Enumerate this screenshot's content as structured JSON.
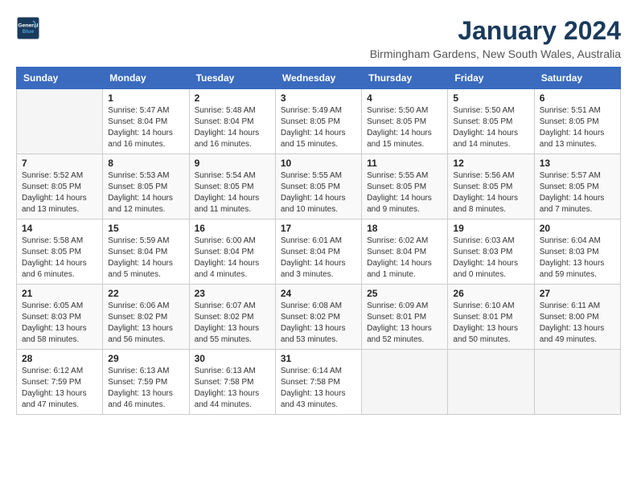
{
  "logo": {
    "line1": "General",
    "line2": "Blue"
  },
  "title": "January 2024",
  "location": "Birmingham Gardens, New South Wales, Australia",
  "weekdays": [
    "Sunday",
    "Monday",
    "Tuesday",
    "Wednesday",
    "Thursday",
    "Friday",
    "Saturday"
  ],
  "weeks": [
    [
      {
        "day": null,
        "info": null
      },
      {
        "day": "1",
        "sunrise": "5:47 AM",
        "sunset": "8:04 PM",
        "daylight": "14 hours and 16 minutes."
      },
      {
        "day": "2",
        "sunrise": "5:48 AM",
        "sunset": "8:04 PM",
        "daylight": "14 hours and 16 minutes."
      },
      {
        "day": "3",
        "sunrise": "5:49 AM",
        "sunset": "8:05 PM",
        "daylight": "14 hours and 15 minutes."
      },
      {
        "day": "4",
        "sunrise": "5:50 AM",
        "sunset": "8:05 PM",
        "daylight": "14 hours and 15 minutes."
      },
      {
        "day": "5",
        "sunrise": "5:50 AM",
        "sunset": "8:05 PM",
        "daylight": "14 hours and 14 minutes."
      },
      {
        "day": "6",
        "sunrise": "5:51 AM",
        "sunset": "8:05 PM",
        "daylight": "14 hours and 13 minutes."
      }
    ],
    [
      {
        "day": "7",
        "sunrise": "5:52 AM",
        "sunset": "8:05 PM",
        "daylight": "14 hours and 13 minutes."
      },
      {
        "day": "8",
        "sunrise": "5:53 AM",
        "sunset": "8:05 PM",
        "daylight": "14 hours and 12 minutes."
      },
      {
        "day": "9",
        "sunrise": "5:54 AM",
        "sunset": "8:05 PM",
        "daylight": "14 hours and 11 minutes."
      },
      {
        "day": "10",
        "sunrise": "5:55 AM",
        "sunset": "8:05 PM",
        "daylight": "14 hours and 10 minutes."
      },
      {
        "day": "11",
        "sunrise": "5:55 AM",
        "sunset": "8:05 PM",
        "daylight": "14 hours and 9 minutes."
      },
      {
        "day": "12",
        "sunrise": "5:56 AM",
        "sunset": "8:05 PM",
        "daylight": "14 hours and 8 minutes."
      },
      {
        "day": "13",
        "sunrise": "5:57 AM",
        "sunset": "8:05 PM",
        "daylight": "14 hours and 7 minutes."
      }
    ],
    [
      {
        "day": "14",
        "sunrise": "5:58 AM",
        "sunset": "8:05 PM",
        "daylight": "14 hours and 6 minutes."
      },
      {
        "day": "15",
        "sunrise": "5:59 AM",
        "sunset": "8:04 PM",
        "daylight": "14 hours and 5 minutes."
      },
      {
        "day": "16",
        "sunrise": "6:00 AM",
        "sunset": "8:04 PM",
        "daylight": "14 hours and 4 minutes."
      },
      {
        "day": "17",
        "sunrise": "6:01 AM",
        "sunset": "8:04 PM",
        "daylight": "14 hours and 3 minutes."
      },
      {
        "day": "18",
        "sunrise": "6:02 AM",
        "sunset": "8:04 PM",
        "daylight": "14 hours and 1 minute."
      },
      {
        "day": "19",
        "sunrise": "6:03 AM",
        "sunset": "8:03 PM",
        "daylight": "14 hours and 0 minutes."
      },
      {
        "day": "20",
        "sunrise": "6:04 AM",
        "sunset": "8:03 PM",
        "daylight": "13 hours and 59 minutes."
      }
    ],
    [
      {
        "day": "21",
        "sunrise": "6:05 AM",
        "sunset": "8:03 PM",
        "daylight": "13 hours and 58 minutes."
      },
      {
        "day": "22",
        "sunrise": "6:06 AM",
        "sunset": "8:02 PM",
        "daylight": "13 hours and 56 minutes."
      },
      {
        "day": "23",
        "sunrise": "6:07 AM",
        "sunset": "8:02 PM",
        "daylight": "13 hours and 55 minutes."
      },
      {
        "day": "24",
        "sunrise": "6:08 AM",
        "sunset": "8:02 PM",
        "daylight": "13 hours and 53 minutes."
      },
      {
        "day": "25",
        "sunrise": "6:09 AM",
        "sunset": "8:01 PM",
        "daylight": "13 hours and 52 minutes."
      },
      {
        "day": "26",
        "sunrise": "6:10 AM",
        "sunset": "8:01 PM",
        "daylight": "13 hours and 50 minutes."
      },
      {
        "day": "27",
        "sunrise": "6:11 AM",
        "sunset": "8:00 PM",
        "daylight": "13 hours and 49 minutes."
      }
    ],
    [
      {
        "day": "28",
        "sunrise": "6:12 AM",
        "sunset": "7:59 PM",
        "daylight": "13 hours and 47 minutes."
      },
      {
        "day": "29",
        "sunrise": "6:13 AM",
        "sunset": "7:59 PM",
        "daylight": "13 hours and 46 minutes."
      },
      {
        "day": "30",
        "sunrise": "6:13 AM",
        "sunset": "7:58 PM",
        "daylight": "13 hours and 44 minutes."
      },
      {
        "day": "31",
        "sunrise": "6:14 AM",
        "sunset": "7:58 PM",
        "daylight": "13 hours and 43 minutes."
      },
      {
        "day": null,
        "info": null
      },
      {
        "day": null,
        "info": null
      },
      {
        "day": null,
        "info": null
      }
    ]
  ],
  "labels": {
    "sunrise": "Sunrise:",
    "sunset": "Sunset:",
    "daylight": "Daylight:"
  }
}
